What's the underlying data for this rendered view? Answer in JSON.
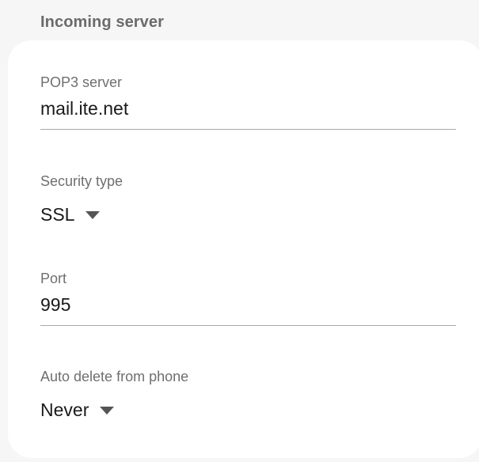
{
  "section": {
    "title": "Incoming server"
  },
  "fields": {
    "pop3_server": {
      "label": "POP3 server",
      "value": "mail.ite.net"
    },
    "security_type": {
      "label": "Security type",
      "value": "SSL"
    },
    "port": {
      "label": "Port",
      "value": "995"
    },
    "auto_delete": {
      "label": "Auto delete from phone",
      "value": "Never"
    }
  },
  "icons": {
    "dropdown": "caret-down-icon"
  },
  "colors": {
    "background": "#f6f6f6",
    "card": "#ffffff",
    "header_text": "#6b6b6b",
    "label_text": "#6f6f6f",
    "value_text": "#1a1a1a",
    "divider": "#a8a8a8"
  }
}
